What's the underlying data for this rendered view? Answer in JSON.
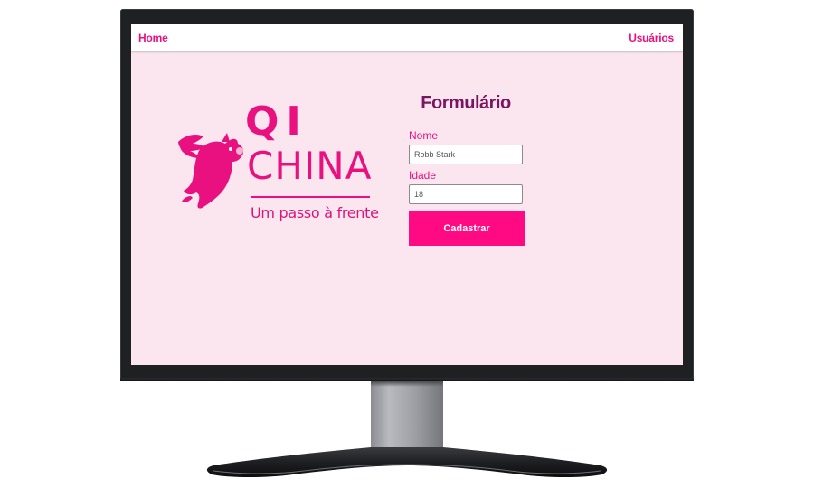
{
  "nav": {
    "home": "Home",
    "users": "Usuários"
  },
  "logo": {
    "line1": "QI",
    "line2": "CHINA",
    "tagline": "Um passo à frente"
  },
  "form": {
    "title": "Formulário",
    "name_label": "Nome",
    "name_value": "Robb Stark",
    "age_label": "Idade",
    "age_value": "18",
    "submit_label": "Cadastrar"
  },
  "colors": {
    "accent": "#e8117f",
    "button": "#ff0a83",
    "title": "#7a1660",
    "background": "#fbe6ef"
  },
  "icons": {
    "logo": "winged-pig-icon"
  }
}
